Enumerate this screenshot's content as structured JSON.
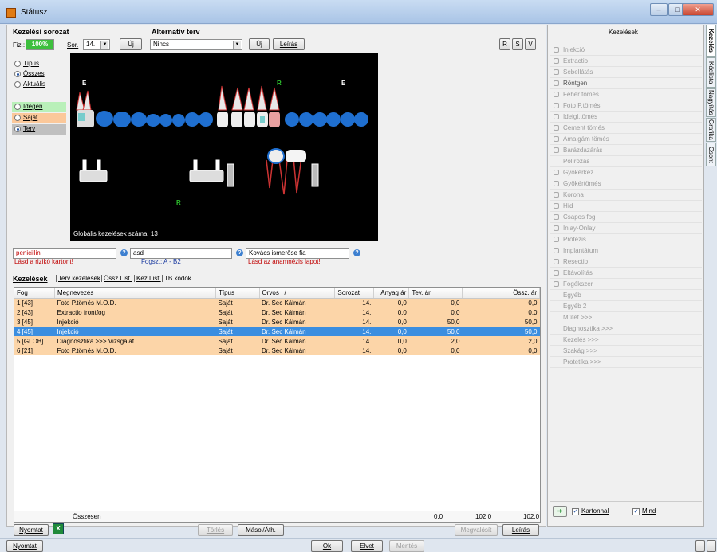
{
  "window": {
    "title": "Státusz",
    "minimize": "–",
    "maximize": "□",
    "close": "✕"
  },
  "header": {
    "series_label": "Kezelési sorozat",
    "fiz_label": "Fiz.:",
    "fiz_value": "100%",
    "sor_label": "Sor.",
    "sor_value": "14.",
    "new_btn": "Új",
    "alt_label": "Alternatív terv",
    "alt_value": "Nincs",
    "alt_new_btn": "Új",
    "alt_desc_btn": "Leírás",
    "right_btns": [
      "R",
      "S",
      "V"
    ]
  },
  "view_options": [
    "Típus",
    "Összes",
    "Aktuális"
  ],
  "legend": [
    "Idegen",
    "Saját",
    "Terv"
  ],
  "dental_chart": {
    "marks_top": [
      "E",
      "R",
      "E"
    ],
    "mark_bottom": "R",
    "global_count": "Globális kezelések száma: 13"
  },
  "alerts": {
    "f1_value": "penicillin",
    "f1_note": "Lásd a rizikó kartont!",
    "f2_value": "asd",
    "f2_note": "Fogsz.: A - B2",
    "f3_value": "Kovács ismerőse fia",
    "f3_note": "Lásd az anamnézis lapot!"
  },
  "tabs": [
    "Kezelések",
    "Terv kezelések",
    "Össz.List.",
    "Kez.List.",
    "TB kódok"
  ],
  "table": {
    "columns": [
      "Fog",
      "Megnevezés",
      "Típus",
      "Orvos",
      "/",
      "Sorozat",
      "Anyag ár",
      "Tev. ár",
      "Össz. ár"
    ],
    "rows": [
      {
        "fog": "1 [43]",
        "name": "Foto P.tömés M.O.D.",
        "type": "Saját",
        "doctor": "Dr. Sec Kálmán",
        "series": "14.",
        "mat": "0,0",
        "work": "0,0",
        "total": "0,0"
      },
      {
        "fog": "2 [43]",
        "name": "Extractio frontfog",
        "type": "Saját",
        "doctor": "Dr. Sec Kálmán",
        "series": "14.",
        "mat": "0,0",
        "work": "0,0",
        "total": "0,0"
      },
      {
        "fog": "3 [45]",
        "name": "Injekció",
        "type": "Saját",
        "doctor": "Dr. Sec Kálmán",
        "series": "14.",
        "mat": "0,0",
        "work": "50,0",
        "total": "50,0"
      },
      {
        "fog": "4 [45]",
        "name": "Injekció",
        "type": "Saját",
        "doctor": "Dr. Sec Kálmán",
        "series": "14.",
        "mat": "0,0",
        "work": "50,0",
        "total": "50,0"
      },
      {
        "fog": "5 [GLOB]",
        "name": "Diagnosztika >>> Vizsgálat",
        "type": "Saját",
        "doctor": "Dr. Sec Kálmán",
        "series": "14.",
        "mat": "0,0",
        "work": "2,0",
        "total": "2,0"
      },
      {
        "fog": "6 [21]",
        "name": "Foto P.tömés M.O.D.",
        "type": "Saját",
        "doctor": "Dr. Sec Kálmán",
        "series": "14.",
        "mat": "0,0",
        "work": "0,0",
        "total": "0,0"
      }
    ],
    "total_label": "Összesen",
    "total_mat": "0,0",
    "total_work": "102,0",
    "total_sum": "102,0"
  },
  "bottom_bar": {
    "print": "Nyomtat",
    "delete": "Törlés",
    "copy": "Másol/Áth.",
    "realized": "Megvalósít",
    "desc": "Leírás"
  },
  "footer": {
    "print": "Nyomtat",
    "ok": "Ok",
    "reject": "Elvet",
    "save": "Mentés"
  },
  "right_panel": {
    "title": "Kezelések",
    "items": [
      "Injekció",
      "Extractio",
      "Sebellátás",
      "Röntgen",
      "Fehér tömés",
      "Foto P.tömés",
      "Ideigl.tömés",
      "Cement tömés",
      "Amalgám tömés",
      "Barázdazárás",
      "Polírozás",
      "Gyökérkez.",
      "Gyökértömés",
      "Korona",
      "Híd",
      "Csapos fog",
      "Inlay-Onlay",
      "Protézis",
      "Implantátum",
      "Resectio",
      "Eltávolítás",
      "Fogékszer",
      "Egyéb",
      "Egyéb 2",
      "Műtét >>>",
      "Diagnosztika >>>",
      "Kezelés >>>",
      "Szakág >>>",
      "Protetika >>>"
    ],
    "check1": "Kartonnal",
    "check2": "Mind"
  },
  "side_tabs": [
    "Kezelés",
    "Kódlista",
    "Nagyítás",
    "Grafika",
    "Csont"
  ]
}
